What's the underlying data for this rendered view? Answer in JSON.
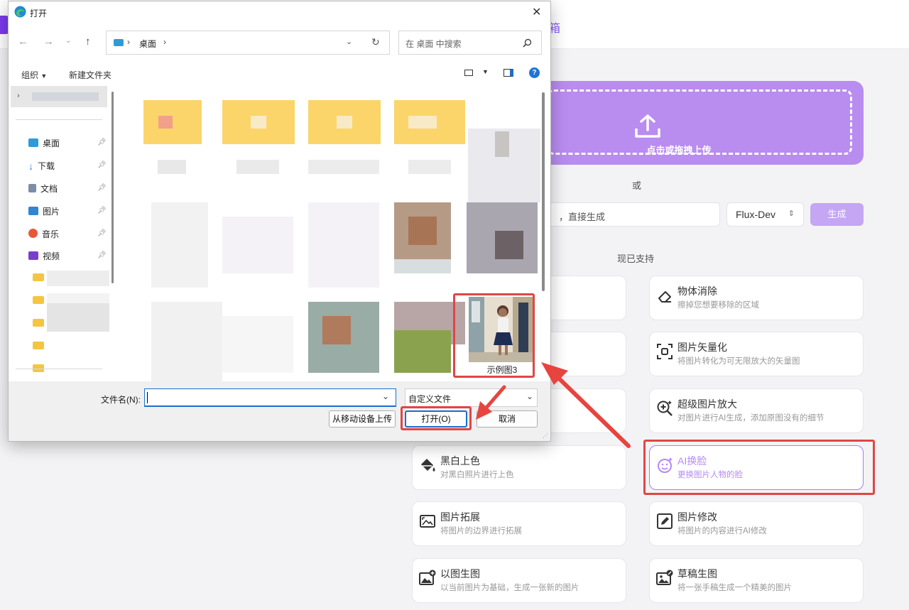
{
  "app": {
    "header_fragment": "箱",
    "upload_label": "点击或拖拽上传",
    "or_label": "或",
    "prompt_fragment": "，直接生成",
    "model_value": "Flux-Dev",
    "generate_label": "生成",
    "support_label": "现已支持",
    "tools": [
      {
        "title": "物体消除",
        "desc": "擦掉您想要移除的区域",
        "icon": "eraser-icon"
      },
      {
        "title": "图片矢量化",
        "desc": "将图片转化为可无限放大的矢量图",
        "icon": "vectorize-icon"
      },
      {
        "title": "超级图片放大",
        "desc": "对图片进行AI生成，添加原图没有的细节",
        "icon": "zoom-plus-icon"
      },
      {
        "title": "黑白上色",
        "desc": "对黑白照片进行上色",
        "icon": "paint-bucket-icon"
      },
      {
        "title": "AI换脸",
        "desc": "更换图片人物的脸",
        "icon": "face-icon",
        "selected": true
      },
      {
        "title": "图片拓展",
        "desc": "将图片的边界进行拓展",
        "icon": "expand-icon"
      },
      {
        "title": "图片修改",
        "desc": "将图片的内容进行AI修改",
        "icon": "edit-icon"
      },
      {
        "title": "以图生图",
        "desc": "以当前图片为基础，生成一张新的图片",
        "icon": "image-plus-icon"
      },
      {
        "title": "草稿生图",
        "desc": "将一张手稿生成一个精美的图片",
        "icon": "sketch-image-icon"
      }
    ]
  },
  "dialog": {
    "title": "打开",
    "address": "桌面",
    "search_placeholder": "在 桌面 中搜索",
    "toolbar": {
      "organize": "组织",
      "new_folder": "新建文件夹"
    },
    "nav_items": [
      {
        "label": "桌面",
        "color": "#2e9bd8"
      },
      {
        "label": "下载",
        "color": "#2a8bd6"
      },
      {
        "label": "文档",
        "color": "#7c8da6"
      },
      {
        "label": "图片",
        "color": "#2f86d4"
      },
      {
        "label": "音乐",
        "color": "#e5583a"
      },
      {
        "label": "视频",
        "color": "#7a3fc9"
      }
    ],
    "selected_file": "示例图3",
    "filename_label": "文件名(N):",
    "filename_value": "",
    "filetype_value": "自定义文件",
    "mobile_upload_label": "从移动设备上传",
    "open_label": "打开(O)",
    "cancel_label": "取消"
  }
}
